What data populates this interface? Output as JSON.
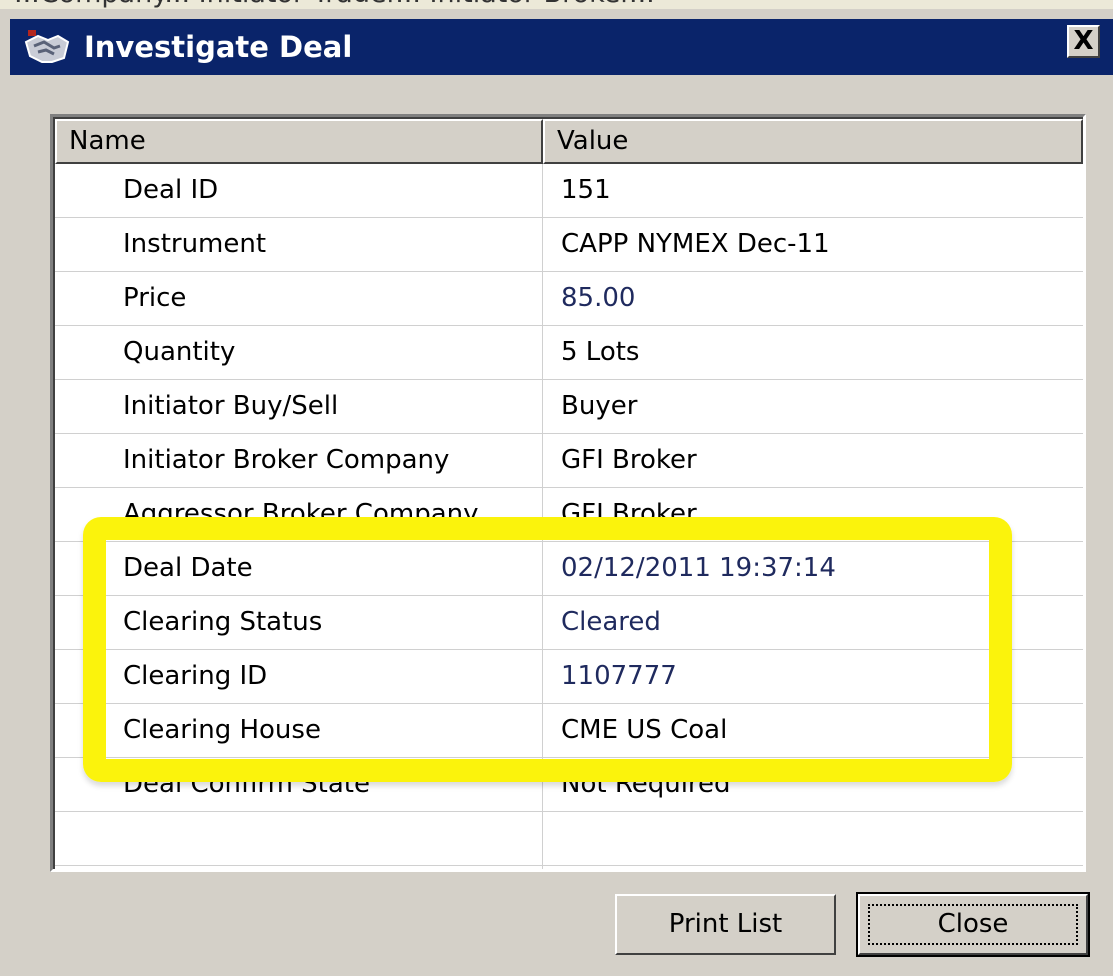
{
  "background_strip_text": "...Company... Initiator Trader... Initiator Broker...",
  "window": {
    "title": "Investigate Deal",
    "close_glyph": "X"
  },
  "list": {
    "columns": [
      "Name",
      "Value"
    ],
    "rows": [
      {
        "name": "Deal ID",
        "value": "151"
      },
      {
        "name": "Instrument",
        "value": "CAPP NYMEX Dec-11"
      },
      {
        "name": "Price",
        "value": "85.00"
      },
      {
        "name": "Quantity",
        "value": "5 Lots"
      },
      {
        "name": "Initiator Buy/Sell",
        "value": "Buyer"
      },
      {
        "name": "Initiator Broker Company",
        "value": "GFI Broker"
      },
      {
        "name": "Aggressor Broker Company",
        "value": "GFI Broker"
      },
      {
        "name": "Deal Date",
        "value": "02/12/2011 19:37:14"
      },
      {
        "name": "Clearing Status",
        "value": "Cleared"
      },
      {
        "name": "Clearing ID",
        "value": "1107777"
      },
      {
        "name": "Clearing House",
        "value": "CME US Coal"
      },
      {
        "name": "Deal Confirm State",
        "value": "Not Required"
      },
      {
        "name": "",
        "value": ""
      }
    ]
  },
  "buttons": {
    "print_list": "Print List",
    "close": "Close"
  },
  "colors": {
    "title_bar": "#0a246a",
    "highlight": "#fbf30c",
    "value_text": "#1f2a5e",
    "dialog_face": "#d4d0c8"
  },
  "icons": {
    "title_icon": "handshake-icon"
  }
}
